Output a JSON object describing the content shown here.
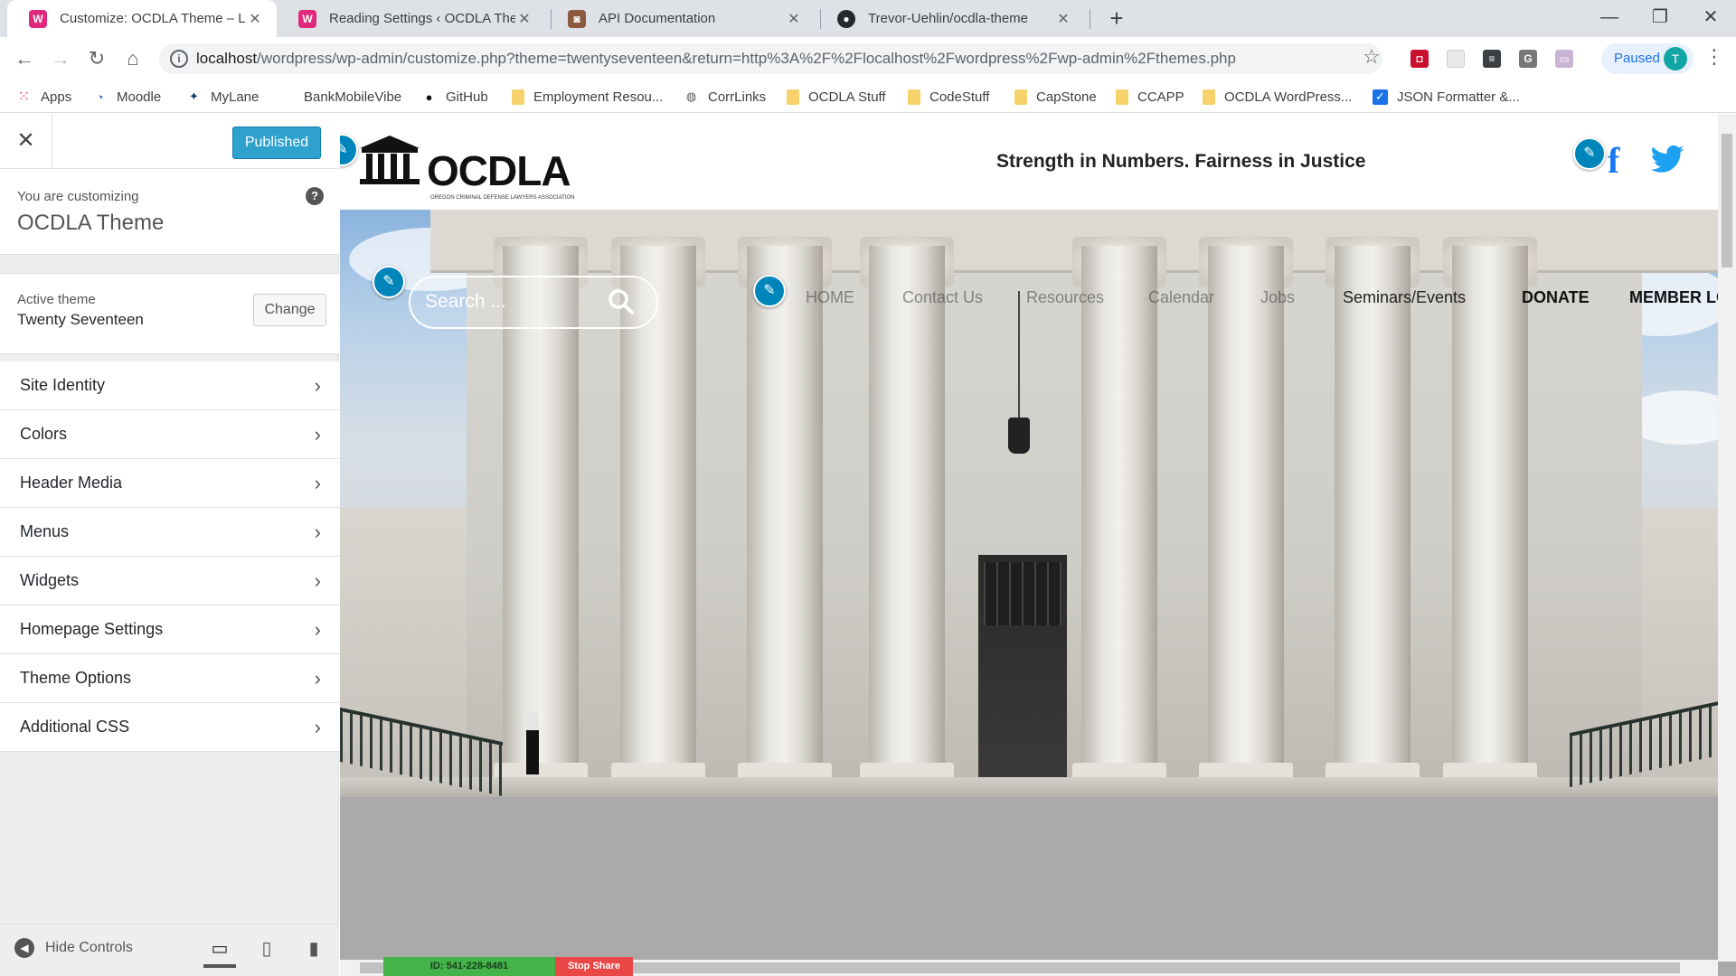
{
  "browser": {
    "tabs": [
      {
        "title": "Customize: OCDLA Theme – Libr",
        "active": true,
        "icon": "theme-icon"
      },
      {
        "title": "Reading Settings ‹ OCDLA Theme",
        "active": false,
        "icon": "theme-icon"
      },
      {
        "title": "API Documentation",
        "active": false,
        "icon": "doc-icon"
      },
      {
        "title": "Trevor-Uehlin/ocdla-theme",
        "active": false,
        "icon": "github-icon"
      }
    ],
    "url_host": "localhost",
    "url_path": "/wordpress/wp-admin/customize.php?theme=twentyseventeen&return=http%3A%2F%2Flocalhost%2Fwordpress%2Fwp-admin%2Fthemes.php",
    "profile_status": "Paused",
    "profile_initial": "T",
    "bookmarks": [
      "Apps",
      "Moodle",
      "MyLane",
      "BankMobileVibe",
      "GitHub",
      "Employment Resou...",
      "CorrLinks",
      "OCDLA Stuff",
      "CodeStuff",
      "CapStone",
      "CCAPP",
      "OCDLA WordPress...",
      "JSON Formatter &..."
    ]
  },
  "customizer": {
    "publish_label": "Published",
    "customizing_label": "You are customizing",
    "site_title": "OCDLA Theme",
    "active_theme_label": "Active theme",
    "active_theme_name": "Twenty Seventeen",
    "change_label": "Change",
    "sections": [
      "Site Identity",
      "Colors",
      "Header Media",
      "Menus",
      "Widgets",
      "Homepage Settings",
      "Theme Options",
      "Additional CSS"
    ],
    "hide_controls_label": "Hide Controls"
  },
  "preview": {
    "logo_text": "OCDLA",
    "logo_subtext": "OREGON CRIMINAL DEFENSE LAWYERS ASSOCIATION",
    "tagline": "Strength in Numbers. Fairness in Justice",
    "search_placeholder": "Search ...",
    "nav": [
      "HOME",
      "Contact Us",
      "Resources",
      "Calendar",
      "Jobs",
      "Seminars/Events",
      "DONATE",
      "MEMBER LO"
    ]
  },
  "screen_share": {
    "id_label": "ID: 541-228-8481",
    "stop_label": "Stop Share"
  },
  "colors": {
    "publish_blue": "#2ea2cc",
    "edit_shortcut": "#0085ba",
    "facebook": "#1877f2",
    "twitter": "#1da1f2"
  }
}
